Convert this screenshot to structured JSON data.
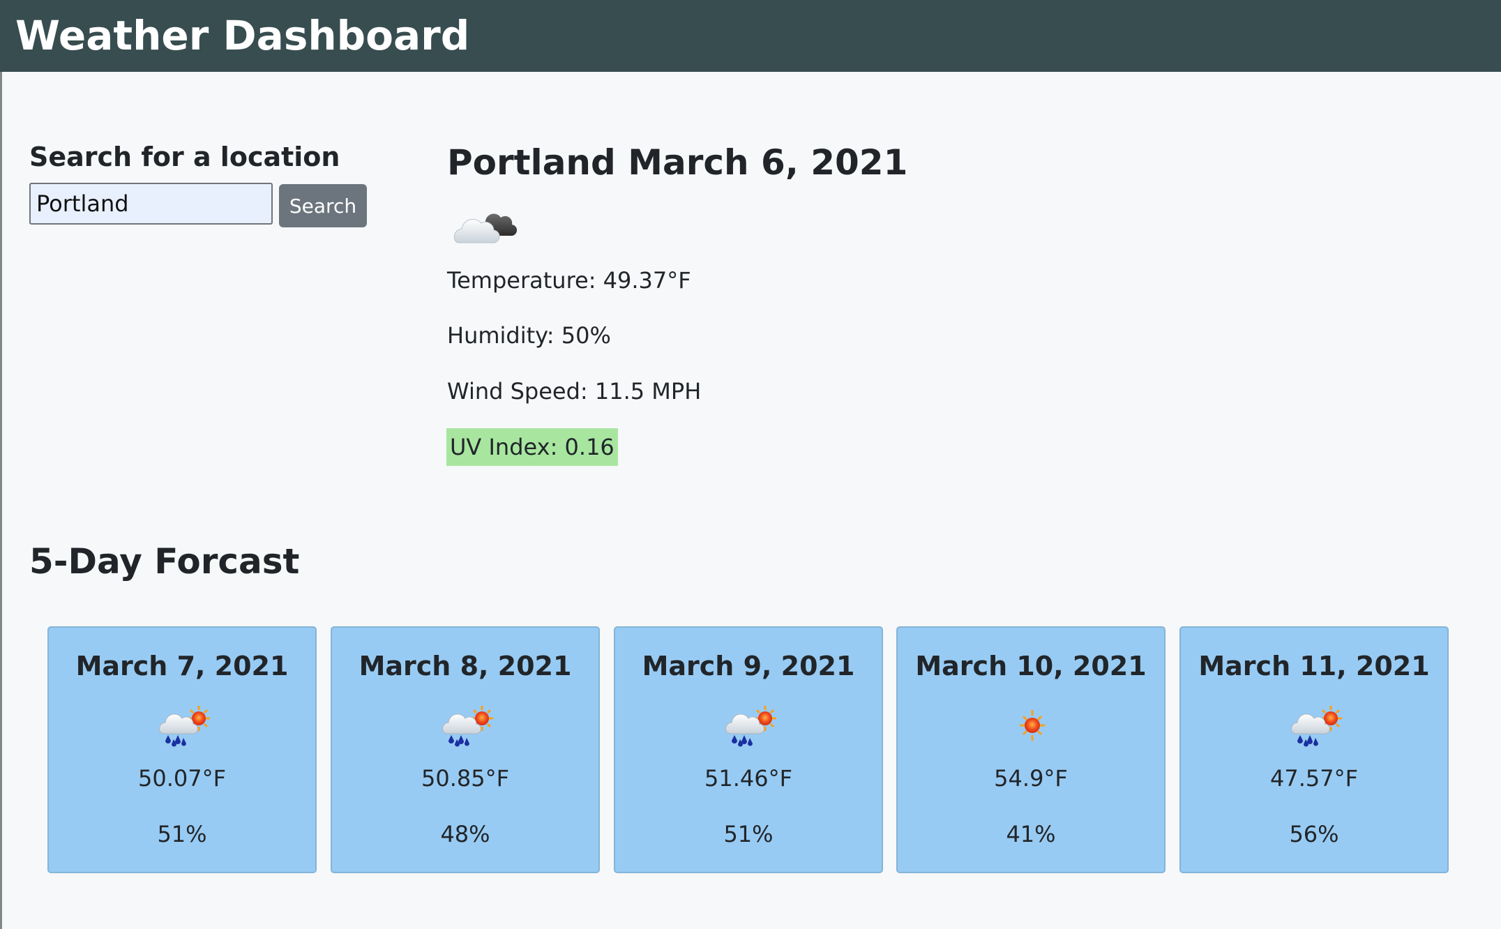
{
  "header": {
    "title": "Weather Dashboard"
  },
  "search": {
    "label": "Search for a location",
    "value": "Portland",
    "button_label": "Search"
  },
  "current": {
    "title": "Portland March 6, 2021",
    "icon": "cloudy-icon",
    "temperature": "Temperature: 49.37°F",
    "humidity": "Humidity: 50%",
    "wind": "Wind Speed: 11.5 MPH",
    "uv": "UV Index: 0.16",
    "uv_color": "#a8e6a0"
  },
  "forecast": {
    "title": "5-Day Forcast",
    "card_color": "#98cbf3",
    "days": [
      {
        "date": "March 7, 2021",
        "icon": "rain-sun-icon",
        "temp": "50.07°F",
        "humidity": "51%"
      },
      {
        "date": "March 8, 2021",
        "icon": "rain-sun-icon",
        "temp": "50.85°F",
        "humidity": "48%"
      },
      {
        "date": "March 9, 2021",
        "icon": "rain-sun-icon",
        "temp": "51.46°F",
        "humidity": "51%"
      },
      {
        "date": "March 10, 2021",
        "icon": "sun-icon",
        "temp": "54.9°F",
        "humidity": "41%"
      },
      {
        "date": "March 11, 2021",
        "icon": "rain-sun-icon",
        "temp": "47.57°F",
        "humidity": "56%"
      }
    ]
  }
}
